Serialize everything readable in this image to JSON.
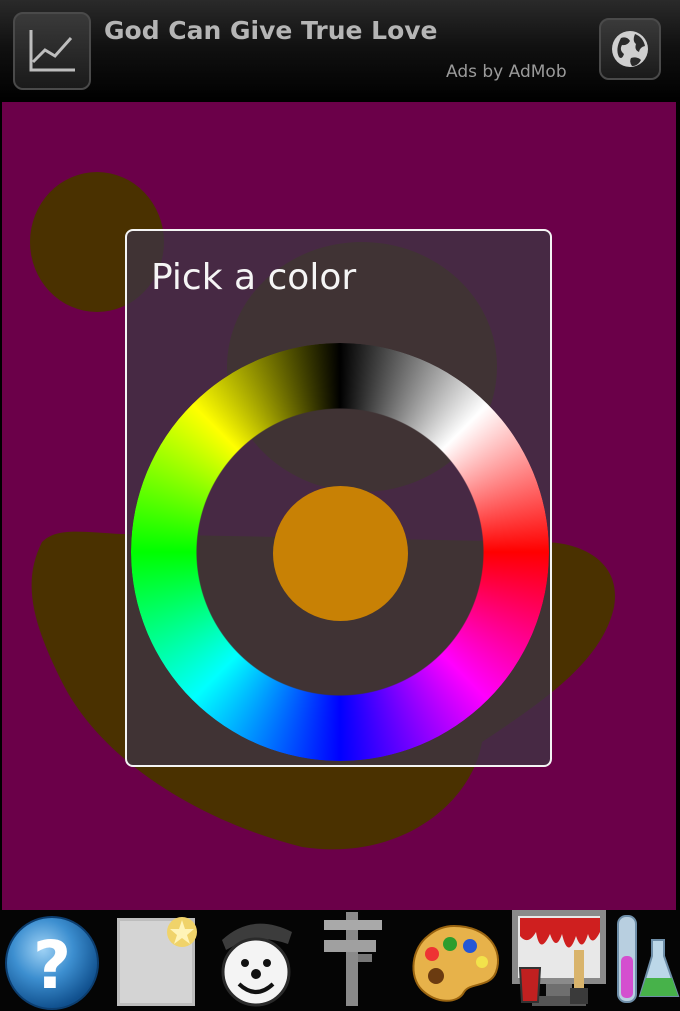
{
  "ad": {
    "title": "God Can Give True Love",
    "subtitle": "Ads by AdMob"
  },
  "canvas": {
    "background": "#6b0049",
    "blob_color": "#4a3100"
  },
  "dialog": {
    "title": "Pick a color",
    "selected_color": "#c88105"
  },
  "toolbar": {
    "tools": [
      {
        "icon": "help-icon"
      },
      {
        "icon": "new-page-icon"
      },
      {
        "icon": "sticker-face-icon"
      },
      {
        "icon": "caliper-icon"
      },
      {
        "icon": "palette-icon"
      },
      {
        "icon": "paint-bucket-icon"
      },
      {
        "icon": "chemistry-icon"
      }
    ]
  }
}
